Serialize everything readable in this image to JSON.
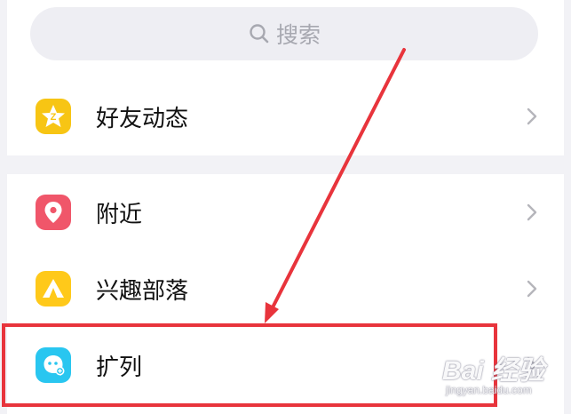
{
  "search": {
    "label": "搜索",
    "icon": "search-icon"
  },
  "items": [
    {
      "label": "好友动态",
      "icon": "qzone-star-icon",
      "color": "#f7c514"
    },
    {
      "label": "附近",
      "icon": "location-pin-icon",
      "color": "#f0566a"
    },
    {
      "label": "兴趣部落",
      "icon": "tribe-tent-icon",
      "color": "#ffc91a"
    },
    {
      "label": "扩列",
      "icon": "kuolie-face-icon",
      "color": "#29c6f0"
    }
  ],
  "annotation": {
    "color": "#e8343c"
  },
  "watermark": {
    "main": "Bai 经验",
    "sub": "jingyan.baidu.com"
  }
}
